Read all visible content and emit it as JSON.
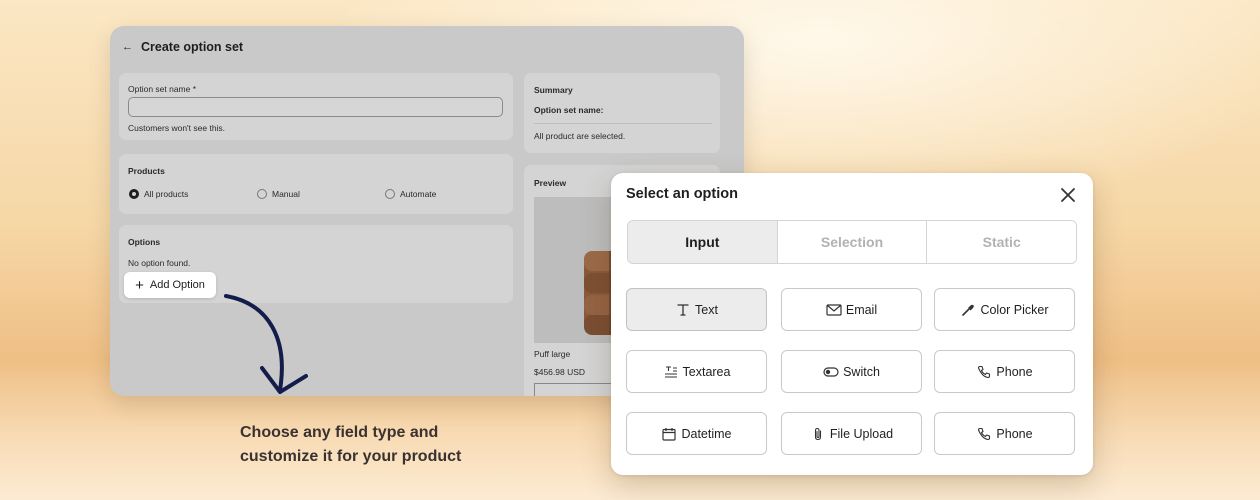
{
  "app": {
    "back_glyph": "←",
    "title": "Create option set",
    "name_card": {
      "label": "Option set name *",
      "value": "",
      "help": "Customers won't see this."
    },
    "products_card": {
      "title": "Products",
      "options": [
        {
          "label": "All products",
          "selected": true
        },
        {
          "label": "Manual",
          "selected": false
        },
        {
          "label": "Automate",
          "selected": false
        }
      ]
    },
    "options_card": {
      "title": "Options",
      "empty_text": "No option found.",
      "add_label": "Add Option"
    },
    "summary_card": {
      "title": "Summary",
      "name_label": "Option set name:",
      "selection_text": "All product are selected."
    },
    "preview_card": {
      "title": "Preview",
      "product_name": "Puff large",
      "price": "$456.98 USD"
    }
  },
  "caption": {
    "line1": "Choose any field type and",
    "line2": "customize it for your product"
  },
  "modal": {
    "title": "Select an option",
    "tabs": [
      {
        "label": "Input",
        "active": true
      },
      {
        "label": "Selection",
        "active": false
      },
      {
        "label": "Static",
        "active": false
      }
    ],
    "fields": [
      {
        "label": "Text",
        "icon": "text-type-icon",
        "selected": true
      },
      {
        "label": "Email",
        "icon": "envelope-icon",
        "selected": false
      },
      {
        "label": "Color Picker",
        "icon": "eyedropper-icon",
        "selected": false
      },
      {
        "label": "Textarea",
        "icon": "textarea-icon",
        "selected": false
      },
      {
        "label": "Switch",
        "icon": "toggle-icon",
        "selected": false
      },
      {
        "label": "Phone",
        "icon": "phone-icon",
        "selected": false
      },
      {
        "label": "Datetime",
        "icon": "calendar-icon",
        "selected": false
      },
      {
        "label": "File Upload",
        "icon": "paperclip-icon",
        "selected": false
      },
      {
        "label": "Phone",
        "icon": "phone-icon",
        "selected": false
      }
    ]
  }
}
